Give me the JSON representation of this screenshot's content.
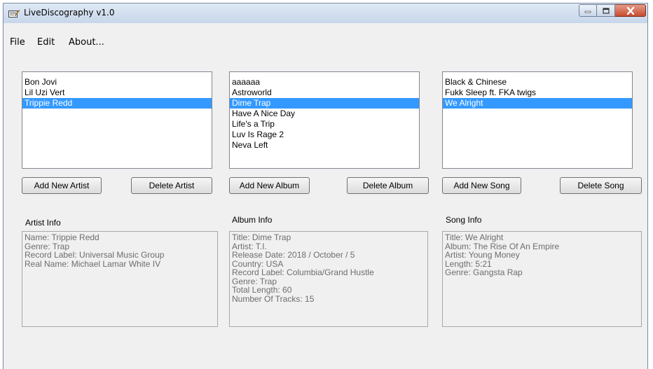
{
  "window": {
    "title": "LiveDiscography v1.0"
  },
  "menu": [
    "File",
    "Edit",
    "About..."
  ],
  "artists": {
    "items": [
      "Bon Jovi",
      "Lil Uzi Vert",
      "Trippie Redd"
    ],
    "selected_index": 2,
    "add_label": "Add New Artist",
    "delete_label": "Delete Artist",
    "info_title": "Artist Info",
    "info_lines": [
      "Name: Trippie Redd",
      "Genre: Trap",
      "Record Label: Universal Music Group",
      "Real Name: Michael Lamar White IV"
    ]
  },
  "albums": {
    "items": [
      "aaaaaa",
      "Astroworld",
      "Dime Trap",
      "Have A Nice Day",
      "Life's a Trip",
      "Luv Is Rage 2",
      "Neva Left"
    ],
    "selected_index": 2,
    "add_label": "Add New Album",
    "delete_label": "Delete Album",
    "info_title": "Album Info",
    "info_lines": [
      "Title: Dime Trap",
      "Artist: T.I.",
      "Release Date: 2018 / October / 5",
      "Country: USA",
      "Record Label: Columbia/Grand Hustle",
      "Genre: Trap",
      "Total Length: 60",
      "Number Of Tracks: 15"
    ]
  },
  "songs": {
    "items": [
      "Black & Chinese",
      "Fukk Sleep ft. FKA twigs",
      "We Alright"
    ],
    "selected_index": 2,
    "add_label": "Add New Song",
    "delete_label": "Delete Song",
    "info_title": "Song Info",
    "info_lines": [
      "Title: We Alright",
      "Album: The Rise Of An Empire",
      "Artist: Young Money",
      "Length: 5:21",
      "Genre: Gangsta Rap"
    ]
  },
  "colors": {
    "selection": "#3399ff",
    "info_text": "#6d6d6d"
  }
}
